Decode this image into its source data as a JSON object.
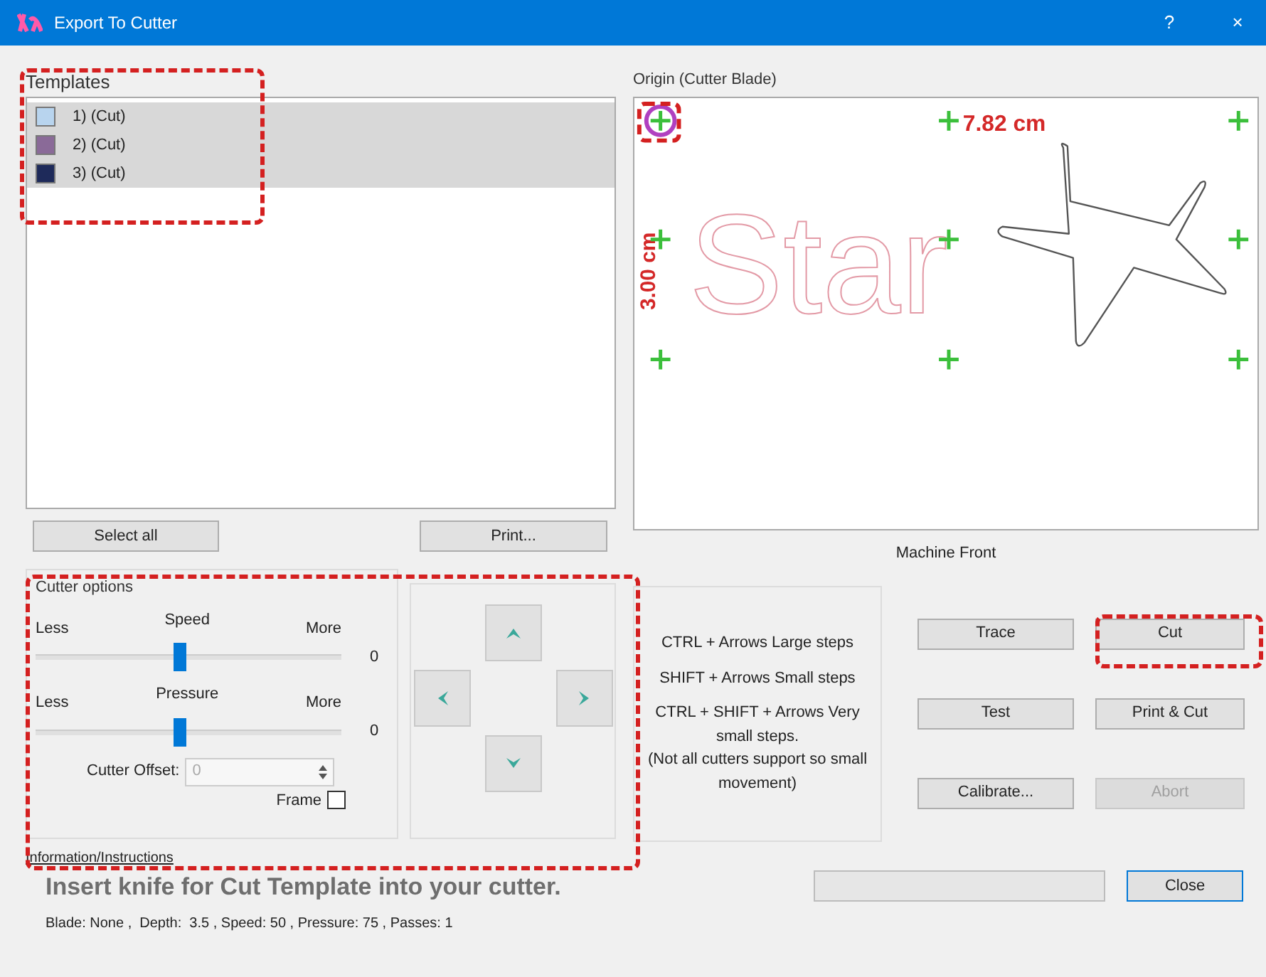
{
  "window": {
    "title": "Export To Cutter",
    "help": "?",
    "close": "×"
  },
  "templates": {
    "label": "Templates",
    "items": [
      {
        "label": "1) (Cut)",
        "color": "#b8d4ee",
        "selected": true
      },
      {
        "label": "2) (Cut)",
        "color": "#8a6a98",
        "selected": true
      },
      {
        "label": "3) (Cut)",
        "color": "#1e2a5a",
        "selected": true
      }
    ],
    "buttons": [
      "Select all",
      "Print..."
    ]
  },
  "origin": {
    "label": "Origin (Cutter Blade)",
    "design_text": "Star",
    "width_label": "7.82 cm",
    "height_label": "3.00 cm",
    "footer": "Machine Front"
  },
  "cutter_options": {
    "title": "Cutter options",
    "sliders": [
      {
        "name": "Speed",
        "min_label": "Less",
        "max_label": "More",
        "level": 0.47,
        "reading": "0"
      },
      {
        "name": "Pressure",
        "min_label": "Less",
        "max_label": "More",
        "level": 0.47,
        "reading": "0"
      }
    ],
    "offset": {
      "label": "Cutter Offset:",
      "value": "0"
    },
    "frame": {
      "label": "Frame",
      "checked": false
    }
  },
  "shortcuts": [
    "CTRL + Arrows  Large steps",
    "SHIFT + Arrows  Small steps",
    "CTRL + SHIFT + Arrows  Very small steps.\n(Not all cutters support so small movement)"
  ],
  "actions": [
    {
      "label": "Trace",
      "disabled": false
    },
    {
      "label": "Cut",
      "disabled": false
    },
    {
      "label": "Test",
      "disabled": false
    },
    {
      "label": "Print & Cut",
      "disabled": false
    },
    {
      "label": "Calibrate...",
      "disabled": false
    },
    {
      "label": "Abort",
      "disabled": true
    }
  ],
  "info": {
    "title": "Information/Instructions",
    "message": "Insert knife for Cut Template into your cutter.",
    "details": "Blade: None ,  Depth:  3.5 , Speed: 50 , Pressure: 75 , Passes: 1",
    "progress": {
      "level": 0
    },
    "close": "Close"
  }
}
